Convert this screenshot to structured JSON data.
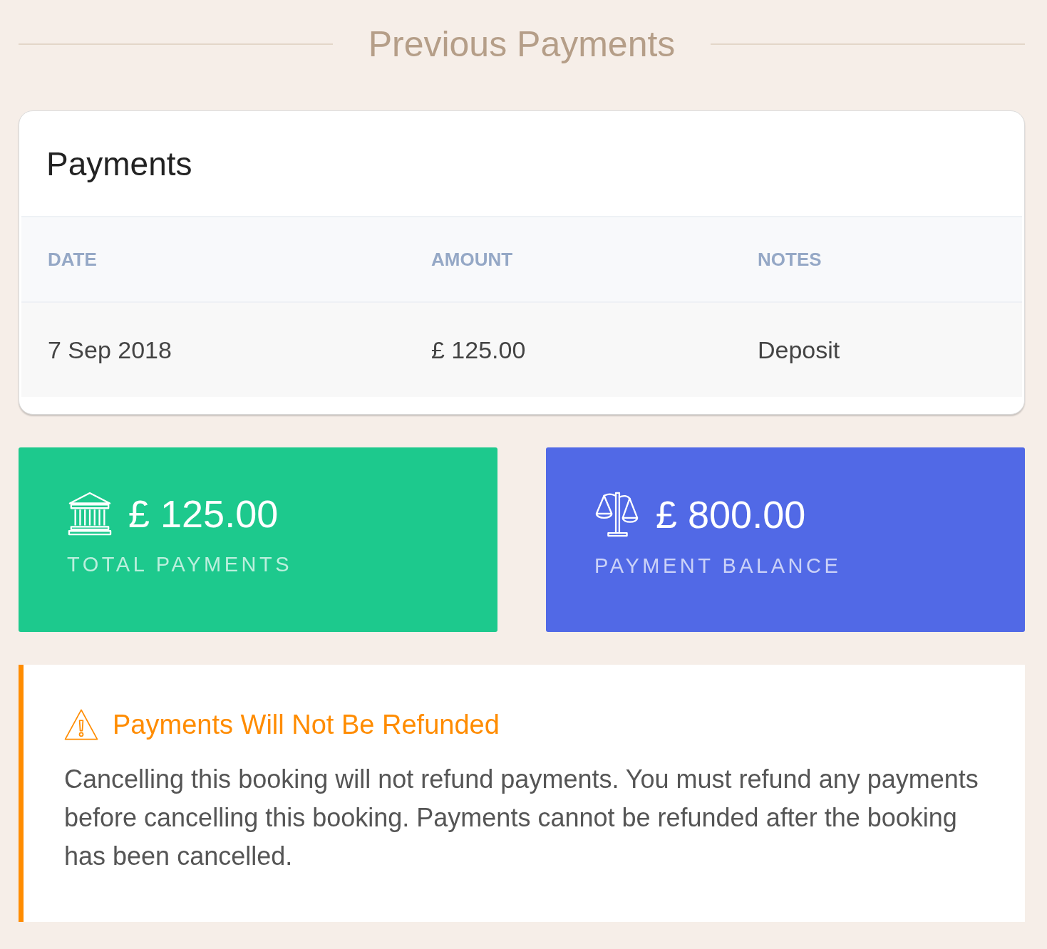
{
  "header": {
    "title": "Previous Payments"
  },
  "payments_card": {
    "title": "Payments",
    "table": {
      "columns": [
        "DATE",
        "AMOUNT",
        "NOTES"
      ],
      "rows": [
        [
          "7 Sep 2018",
          "£ 125.00",
          "Deposit"
        ]
      ]
    }
  },
  "stats": [
    {
      "kind": "bank",
      "amount": "£ 125.00",
      "label": "TOTAL PAYMENTS",
      "color": "#1dc98d"
    },
    {
      "kind": "scale",
      "amount": "£ 800.00",
      "label": "PAYMENT BALANCE",
      "color": "#5169e6"
    }
  ],
  "alert": {
    "kind": "warning",
    "title": "Payments Will Not Be Refunded",
    "body": "Cancelling this booking will not refund payments. You must refund any payments before cancelling this booking. Payments cannot be refunded after the booking has been cancelled."
  }
}
